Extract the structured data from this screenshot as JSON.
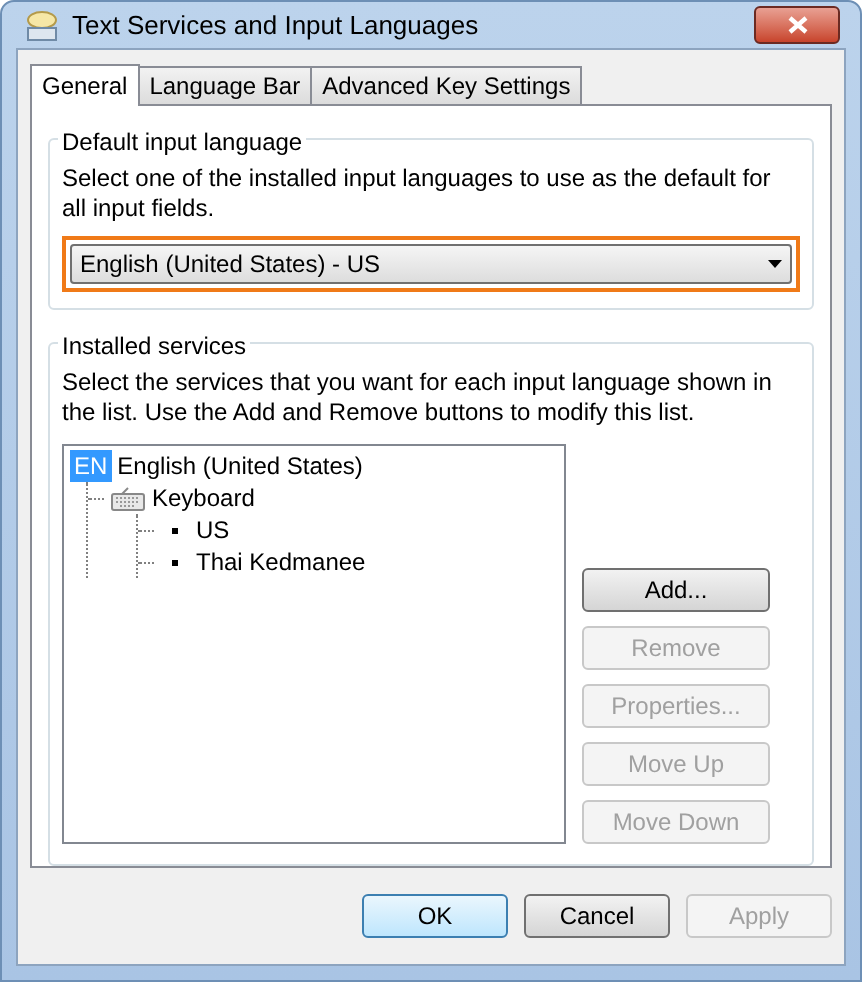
{
  "window": {
    "title": "Text Services and Input Languages"
  },
  "tabs": [
    {
      "label": "General",
      "selected": true
    },
    {
      "label": "Language Bar",
      "selected": false
    },
    {
      "label": "Advanced Key Settings",
      "selected": false
    }
  ],
  "default_input_language": {
    "legend": "Default input language",
    "description": "Select one of the installed input languages to use as the default for all input fields.",
    "dropdown": {
      "value": "English (United States) - US",
      "highlighted": true
    }
  },
  "installed_services": {
    "legend": "Installed services",
    "description": "Select the services that you want for each input language shown in the list. Use the Add and Remove buttons to modify this list.",
    "tree": [
      {
        "badge": "EN",
        "label": "English (United States)",
        "kind": "language",
        "children": [
          {
            "label": "Keyboard",
            "kind": "category",
            "children": [
              {
                "label": "US",
                "kind": "layout"
              },
              {
                "label": "Thai Kedmanee",
                "kind": "layout"
              }
            ]
          }
        ]
      }
    ],
    "buttons": [
      {
        "label": "Add...",
        "disabled": false
      },
      {
        "label": "Remove",
        "disabled": true
      },
      {
        "label": "Properties...",
        "disabled": true
      },
      {
        "label": "Move Up",
        "disabled": true
      },
      {
        "label": "Move Down",
        "disabled": true
      }
    ]
  },
  "footer_buttons": [
    {
      "label": "OK",
      "disabled": false,
      "default": true
    },
    {
      "label": "Cancel",
      "disabled": false,
      "default": false
    },
    {
      "label": "Apply",
      "disabled": true,
      "default": false
    }
  ]
}
